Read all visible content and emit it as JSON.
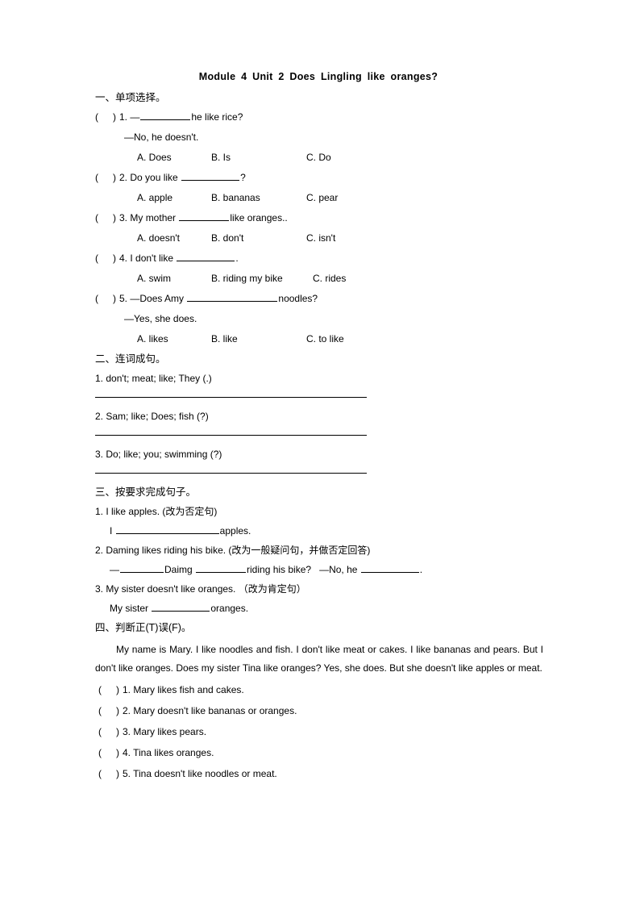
{
  "document": {
    "title": "Module 4 Unit 2 Does Lingling like oranges?"
  },
  "section1": {
    "heading": "一、单项选择。",
    "questions": [
      {
        "number": "1.",
        "stem_pre": "—",
        "stem_post": "he like rice?",
        "reply": "—No, he doesn't.",
        "options": [
          "A. Does",
          "B. Is",
          "C. Do"
        ]
      },
      {
        "number": "2.",
        "stem_pre": "Do you like ",
        "stem_post": "?",
        "reply": "",
        "options": [
          "A. apple",
          "B. bananas",
          "C. pear"
        ]
      },
      {
        "number": "3.",
        "stem_pre": "My mother ",
        "stem_post": "like oranges..",
        "reply": "",
        "options": [
          "A. doesn't",
          "B. don't",
          "C. isn't"
        ]
      },
      {
        "number": "4.",
        "stem_pre": "I don't like ",
        "stem_post": ".",
        "reply": "",
        "options": [
          "A. swim",
          "B. riding my bike",
          "C. rides"
        ]
      },
      {
        "number": "5.",
        "stem_pre": "—Does Amy ",
        "stem_post": "noodles?",
        "reply": "—Yes, she does.",
        "options": [
          "A. likes",
          "B. like",
          "C. to like"
        ]
      }
    ]
  },
  "section2": {
    "heading": "二、连词成句。",
    "items": [
      "1. don't; meat; like; They (.)",
      "2. Sam; like; Does; fish (?)",
      "3. Do; like; you; swimming (?)"
    ]
  },
  "section3": {
    "heading": "三、按要求完成句子。",
    "items": [
      {
        "prompt": "1. I like apples. (改为否定句)",
        "answer_pre": "I ",
        "answer_mid": "",
        "answer_post": "apples.",
        "answer_tail": ""
      },
      {
        "prompt": "2. Daming likes riding his bike. (改为一般疑问句，并做否定回答)",
        "answer_pre": "—",
        "answer_mid": "Daimg ",
        "answer_post": "riding his bike?",
        "answer_tail": "—No, he "
      },
      {
        "prompt": "3. My sister doesn't like oranges. （改为肯定句）",
        "answer_pre": "My sister ",
        "answer_mid": "",
        "answer_post": "oranges.",
        "answer_tail": ""
      }
    ]
  },
  "section4": {
    "heading": "四、判断正(T)误(F)。",
    "passage": "My name is Mary. I like noodles and fish. I don't like meat or cakes. I like bananas and pears. But I don't like oranges. Does my sister Tina like oranges? Yes, she does. But she doesn't like apples or meat.",
    "statements": [
      "1. Mary likes fish and cakes.",
      "2. Mary doesn't like bananas or oranges.",
      "3. Mary likes pears.",
      "4. Tina likes oranges.",
      "5. Tina doesn't like noodles or meat."
    ]
  }
}
